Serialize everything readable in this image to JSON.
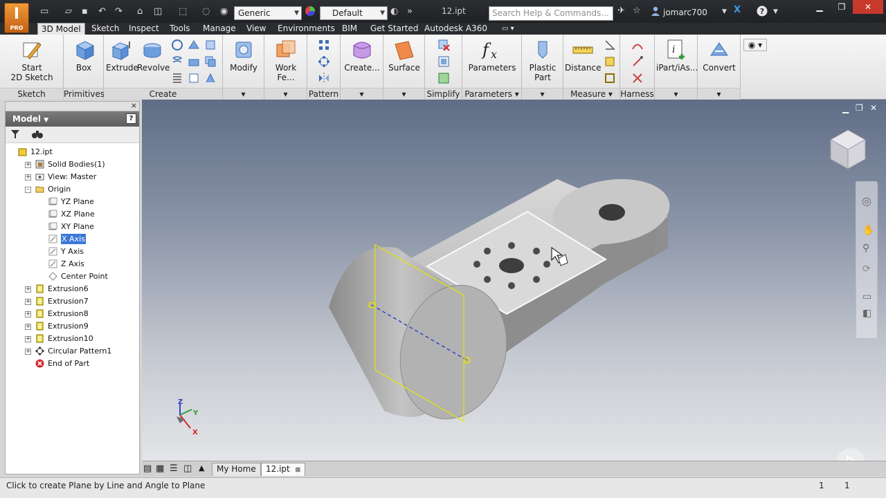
{
  "titlebar": {
    "app_letter": "I",
    "app_edition": "PRO",
    "material_combo": "Generic",
    "appearance_combo": "Default",
    "document_title": "12.ipt",
    "search_placeholder": "Search Help & Commands...",
    "user_name": "jomarc700"
  },
  "tabs": [
    "3D Model",
    "Sketch",
    "Inspect",
    "Tools",
    "Manage",
    "View",
    "Environments",
    "BIM",
    "Get Started",
    "Autodesk A360"
  ],
  "active_tab": "3D Model",
  "ribbon": {
    "panels": {
      "sketch": "Sketch",
      "primitives": "Primitives",
      "create": "Create",
      "pattern": "Pattern",
      "simplify": "Simplify",
      "parameters": "Parameters",
      "measure": "Measure",
      "harness": "Harness"
    },
    "buttons": {
      "start_sketch_line1": "Start",
      "start_sketch_line2": "2D Sketch",
      "box": "Box",
      "extrude": "Extrude",
      "revolve": "Revolve",
      "modify": "Modify",
      "work_features": "Work Fe...",
      "create_freeform": "Create...",
      "surface": "Surface",
      "parameters": "Parameters",
      "plastic_part": "Plastic Part",
      "distance": "Distance",
      "ipart": "iPart/iAs...",
      "convert": "Convert"
    }
  },
  "browser": {
    "title": "Model",
    "help_glyph": "?",
    "tree": [
      {
        "label": "12.ipt",
        "indent": 0,
        "expander": "",
        "icon": "part-icon"
      },
      {
        "label": "Solid Bodies(1)",
        "indent": 1,
        "expander": "+",
        "icon": "solid-bodies-icon"
      },
      {
        "label": "View: Master",
        "indent": 1,
        "expander": "+",
        "icon": "view-icon"
      },
      {
        "label": "Origin",
        "indent": 1,
        "expander": "-",
        "icon": "folder-icon"
      },
      {
        "label": "YZ Plane",
        "indent": 2,
        "expander": "",
        "icon": "plane-icon"
      },
      {
        "label": "XZ Plane",
        "indent": 2,
        "expander": "",
        "icon": "plane-icon"
      },
      {
        "label": "XY Plane",
        "indent": 2,
        "expander": "",
        "icon": "plane-icon"
      },
      {
        "label": "X Axis",
        "indent": 2,
        "expander": "",
        "icon": "axis-icon",
        "selected": true
      },
      {
        "label": "Y Axis",
        "indent": 2,
        "expander": "",
        "icon": "axis-icon"
      },
      {
        "label": "Z Axis",
        "indent": 2,
        "expander": "",
        "icon": "axis-icon"
      },
      {
        "label": "Center Point",
        "indent": 2,
        "expander": "",
        "icon": "center-point-icon"
      },
      {
        "label": "Extrusion6",
        "indent": 1,
        "expander": "+",
        "icon": "extrusion-icon"
      },
      {
        "label": "Extrusion7",
        "indent": 1,
        "expander": "+",
        "icon": "extrusion-icon"
      },
      {
        "label": "Extrusion8",
        "indent": 1,
        "expander": "+",
        "icon": "extrusion-icon"
      },
      {
        "label": "Extrusion9",
        "indent": 1,
        "expander": "+",
        "icon": "extrusion-icon"
      },
      {
        "label": "Extrusion10",
        "indent": 1,
        "expander": "+",
        "icon": "extrusion-icon"
      },
      {
        "label": "Circular Pattern1",
        "indent": 1,
        "expander": "+",
        "icon": "pattern-icon"
      },
      {
        "label": "End of Part",
        "indent": 1,
        "expander": "",
        "icon": "end-of-part-icon"
      }
    ]
  },
  "viewport": {
    "triad_labels": {
      "x": "X",
      "y": "Y",
      "z": "Z"
    }
  },
  "doc_tabs": {
    "home": "My Home",
    "active": "12.ipt"
  },
  "status": {
    "message": "Click to create Plane by Line and Angle to Plane",
    "count1": "1",
    "count2": "1"
  },
  "colors": {
    "accent_orange": "#e8862a",
    "selection_blue": "#3b78d8",
    "sketch_yellow": "#e6e600"
  }
}
